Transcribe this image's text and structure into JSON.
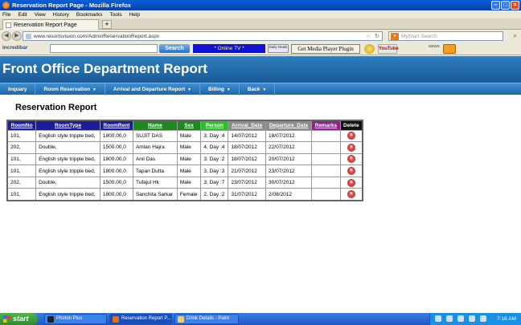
{
  "window": {
    "title": "Reservation Report Page - Mozilla Firefox"
  },
  "menu": [
    "File",
    "Edit",
    "View",
    "History",
    "Bookmarks",
    "Tools",
    "Help"
  ],
  "tab": {
    "title": "Reservation Report Page",
    "new_tab": "+"
  },
  "address": {
    "url": "www.resortsvision.com/AdminReservationReport.aspx"
  },
  "search": {
    "placeholder": "MyStart Search"
  },
  "toolbar": {
    "incredibar": "incredibar",
    "search_button": "Search",
    "online_tv": "* Online TV *",
    "daily_deals": "Daily Deals",
    "media_plugin": "Get Media Player Plugin",
    "youtube": "YouTube",
    "news": "NEWS"
  },
  "page": {
    "header": "Front Office Department Report",
    "nav": [
      "Inquary",
      "Room Reservation",
      "Arrival and Departure Report",
      "Billing",
      "Back"
    ],
    "report_title": "Reservation Report"
  },
  "table": {
    "columns": [
      {
        "label": "RoomNo",
        "color": "#1b1b9c"
      },
      {
        "label": "RoomType",
        "color": "#1b1b9c"
      },
      {
        "label": "RoomRent",
        "color": "#1b1b9c"
      },
      {
        "label": "Name",
        "color": "#1e8a1e"
      },
      {
        "label": "Sex",
        "color": "#1e8a1e"
      },
      {
        "label": "Person",
        "color": "#2bbf2b"
      },
      {
        "label": "Arrival_Date",
        "color": "#8c8c8c"
      },
      {
        "label": "Departure_Date",
        "color": "#8c8c8c"
      },
      {
        "label": "Remarks",
        "color": "#8e238e"
      },
      {
        "label": "Delete",
        "color": "#111111"
      }
    ],
    "rows": [
      [
        "101,",
        "English style tripple bed,",
        "1800.00,0",
        "SUJIT DAS",
        "Male",
        "3, Day :4",
        "14/07/2012",
        "18/07/2012",
        ""
      ],
      [
        "202,",
        "Double,",
        "1500.00,0",
        "Amlan Hajra",
        "Male",
        "4, Day :4",
        "18/07/2012",
        "22/07/2012",
        ""
      ],
      [
        "101,",
        "English style tripple bed,",
        "1800.00,0",
        "Anil Das",
        "Male",
        "3, Day :2",
        "18/07/2012",
        "20/07/2012",
        ""
      ],
      [
        "101,",
        "English style tripple bed,",
        "1800.00,0",
        "Tapan Dutta",
        "Male",
        "3, Day :3",
        "21/07/2012",
        "23/07/2012",
        ""
      ],
      [
        "202,",
        "Double,",
        "1500.00,0",
        "Tufajul Hk",
        "Male",
        "3, Day :7",
        "23/07/2012",
        "30/07/2012",
        ""
      ],
      [
        "101,",
        "English style tripple bed,",
        "1800.00,0",
        "Sanchita Sarkar",
        "Female",
        "2, Day :2",
        "31/07/2012",
        "2/08/2012",
        ""
      ]
    ]
  },
  "taskbar": {
    "start": "start",
    "items": [
      "Photon Plus",
      "Reservation Report P...",
      "Drink Details - Paint"
    ],
    "clock": "7:16 AM"
  },
  "colors": {
    "header_blue": "#2e7fbf",
    "nav_blue": "#2a74b8",
    "delete_red": "#c82020"
  }
}
